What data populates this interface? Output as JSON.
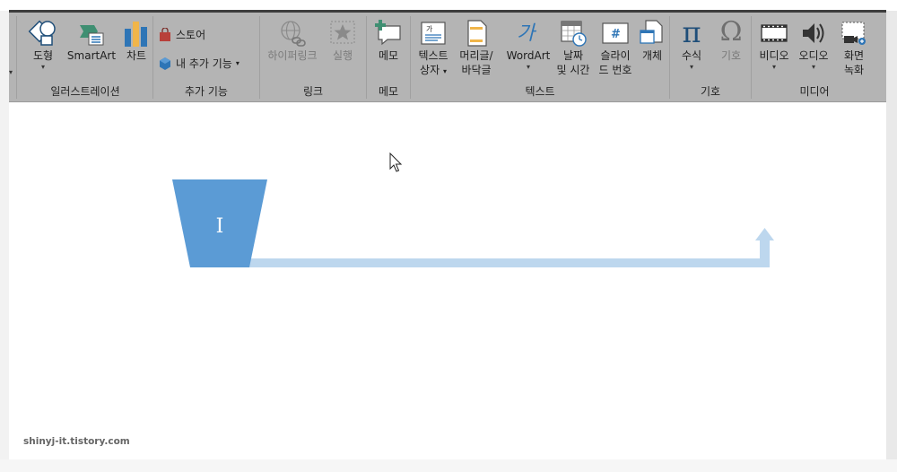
{
  "ribbon": {
    "groups": {
      "illustrations": {
        "label": "일러스트레이션",
        "shapes": "도형",
        "smartart": "SmartArt",
        "chart": "차트"
      },
      "addins": {
        "label": "추가 기능",
        "store": "스토어",
        "my_addins": "내 추가 기능"
      },
      "links": {
        "label": "링크",
        "hyperlink": "하이퍼링크",
        "action": "실행"
      },
      "comments": {
        "label": "메모",
        "comment": "메모"
      },
      "text": {
        "label": "텍스트",
        "textbox_l1": "텍스트",
        "textbox_l2": "상자",
        "header_l1": "머리글/",
        "header_l2": "바닥글",
        "wordart": "WordArt",
        "datetime_l1": "날짜",
        "datetime_l2": "및 시간",
        "slideno_l1": "슬라이",
        "slideno_l2": "드 번호",
        "object": "개체"
      },
      "symbols": {
        "label": "기호",
        "equation": "수식",
        "symbol": "기호"
      },
      "media": {
        "label": "미디어",
        "video": "비디오",
        "audio": "오디오",
        "screenrec_l1": "화면",
        "screenrec_l2": "녹화"
      }
    }
  },
  "canvas": {
    "shape_fill": "#5b9bd5",
    "arrow_fill": "#bdd7ee",
    "cursor_text": "I"
  },
  "watermark": "shinyj-it.tistory.com"
}
